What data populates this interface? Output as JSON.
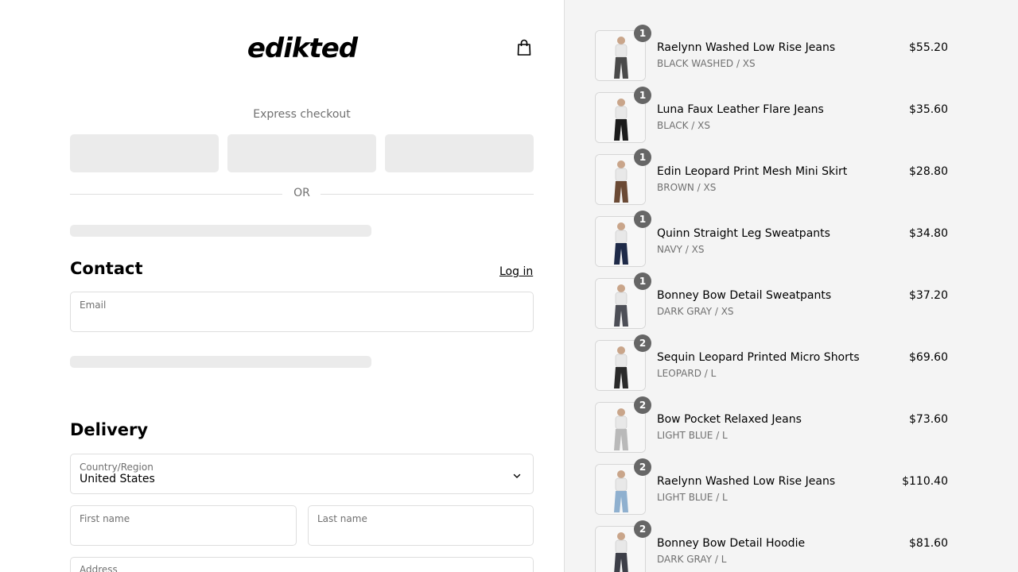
{
  "brand": {
    "logo_text": "edikted"
  },
  "express": {
    "label": "Express checkout",
    "or_text": "OR"
  },
  "contact": {
    "title": "Contact",
    "login_label": "Log in",
    "email_label": "Email"
  },
  "delivery": {
    "title": "Delivery",
    "country_label": "Country/Region",
    "country_value": "United States",
    "first_name_label": "First name",
    "last_name_label": "Last name",
    "address_label": "Address"
  },
  "cart": {
    "items": [
      {
        "name": "Raelynn Washed Low Rise Jeans",
        "variant": "BLACK WASHED / XS",
        "price": "$55.20",
        "qty": "1",
        "tone": "#4a4a4a"
      },
      {
        "name": "Luna Faux Leather Flare Jeans",
        "variant": "BLACK / XS",
        "price": "$35.60",
        "qty": "1",
        "tone": "#1c1c1c"
      },
      {
        "name": "Edin Leopard Print Mesh Mini Skirt",
        "variant": "BROWN / XS",
        "price": "$28.80",
        "qty": "1",
        "tone": "#6b4a35"
      },
      {
        "name": "Quinn Straight Leg Sweatpants",
        "variant": "NAVY / XS",
        "price": "$34.80",
        "qty": "1",
        "tone": "#1e2a48"
      },
      {
        "name": "Bonney Bow Detail Sweatpants",
        "variant": "DARK GRAY / XS",
        "price": "$37.20",
        "qty": "1",
        "tone": "#4d4f57"
      },
      {
        "name": "Sequin Leopard Printed Micro Shorts",
        "variant": "LEOPARD / L",
        "price": "$69.60",
        "qty": "2",
        "tone": "#2a2a2a"
      },
      {
        "name": "Bow Pocket Relaxed Jeans",
        "variant": "LIGHT BLUE / L",
        "price": "$73.60",
        "qty": "2",
        "tone": "#b9b9b9"
      },
      {
        "name": "Raelynn Washed Low Rise Jeans",
        "variant": "LIGHT BLUE / L",
        "price": "$110.40",
        "qty": "2",
        "tone": "#8fb0cf"
      },
      {
        "name": "Bonney Bow Detail Hoodie",
        "variant": "DARK GRAY / L",
        "price": "$81.60",
        "qty": "2",
        "tone": "#3d3f48"
      }
    ]
  }
}
